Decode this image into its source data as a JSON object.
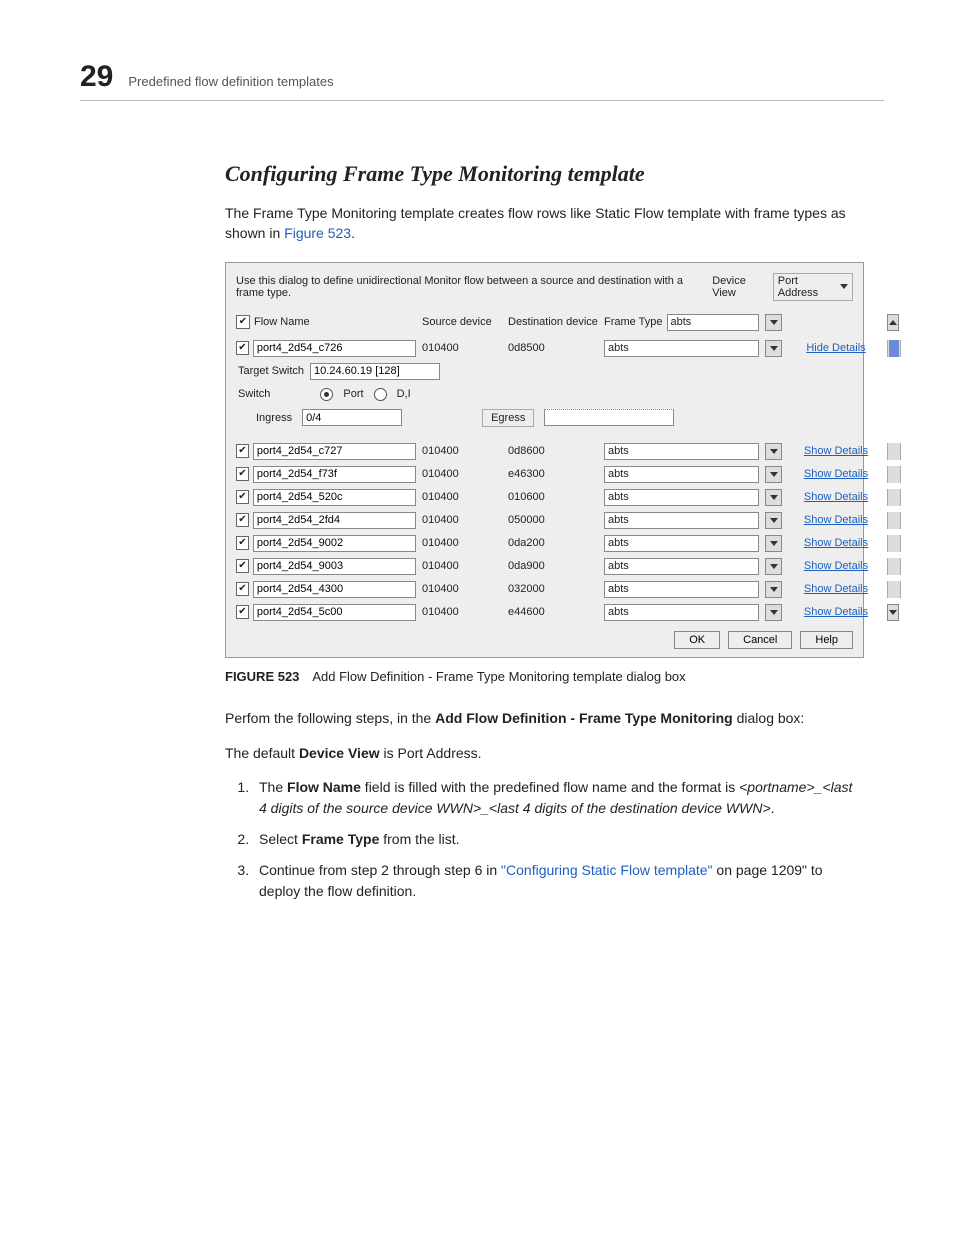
{
  "header": {
    "chapter_number": "29",
    "chapter_title": "Predefined flow definition templates"
  },
  "section_title": "Configuring Frame Type Monitoring template",
  "intro_1": "The Frame Type Monitoring template creates flow rows like Static Flow template with frame types as shown in ",
  "intro_link": "Figure 523",
  "intro_2": ".",
  "dialog": {
    "instruction": "Use this dialog to define unidirectional Monitor flow between a source and destination with a frame type.",
    "device_view_label": "Device View",
    "device_view_value": "Port Address",
    "columns": {
      "flow_name": "Flow Name",
      "source_device": "Source device",
      "destination_device": "Destination device",
      "frame_type_label": "Frame Type",
      "frame_type_value": "abts"
    },
    "hide_details": "Hide Details",
    "show_details": "Show Details",
    "expanded": {
      "flow_name": "port4_2d54_c726",
      "source_device": "010400",
      "destination_device": "0d8500",
      "frame_type": "abts",
      "target_switch_label": "Target Switch",
      "target_switch_value": "10.24.60.19 [128]",
      "switch_label": "Switch",
      "port_radio": "Port",
      "dj_radio": "D,I",
      "ingress_label": "Ingress",
      "ingress_value": "0/4",
      "egress_label": "Egress"
    },
    "rows": [
      {
        "flow_name": "port4_2d54_c727",
        "source": "010400",
        "dest": "0d8600",
        "ft": "abts"
      },
      {
        "flow_name": "port4_2d54_f73f",
        "source": "010400",
        "dest": "e46300",
        "ft": "abts"
      },
      {
        "flow_name": "port4_2d54_520c",
        "source": "010400",
        "dest": "010600",
        "ft": "abts"
      },
      {
        "flow_name": "port4_2d54_2fd4",
        "source": "010400",
        "dest": "050000",
        "ft": "abts"
      },
      {
        "flow_name": "port4_2d54_9002",
        "source": "010400",
        "dest": "0da200",
        "ft": "abts"
      },
      {
        "flow_name": "port4_2d54_9003",
        "source": "010400",
        "dest": "0da900",
        "ft": "abts"
      },
      {
        "flow_name": "port4_2d54_4300",
        "source": "010400",
        "dest": "032000",
        "ft": "abts"
      },
      {
        "flow_name": "port4_2d54_5c00",
        "source": "010400",
        "dest": "e44600",
        "ft": "abts"
      }
    ],
    "buttons": {
      "ok": "OK",
      "cancel": "Cancel",
      "help": "Help"
    }
  },
  "figure": {
    "label": "FIGURE 523",
    "caption": "Add Flow Definition - Frame Type Monitoring template dialog box"
  },
  "p2_a": "Perfom the following steps, in the ",
  "p2_b": "Add Flow Definition - Frame Type Monitoring",
  "p2_c": " dialog box:",
  "p3_a": "The default ",
  "p3_b": "Device View",
  "p3_c": " is Port Address.",
  "steps": {
    "s1a": "The ",
    "s1b": "Flow Name",
    "s1c": " field is filled with the predefined flow name and the format is ",
    "s1d": "<portname>_<last 4 digits of the source device WWN>_<last 4 digits of the destination device WWN>",
    "s1e": ".",
    "s2a": "Select ",
    "s2b": "Frame Type",
    "s2c": " from the list.",
    "s3a": "Continue from step 2 through step 6 in ",
    "s3b": "\"Configuring Static Flow template\"",
    "s3c": " on page 1209\" to deploy the flow definition."
  }
}
